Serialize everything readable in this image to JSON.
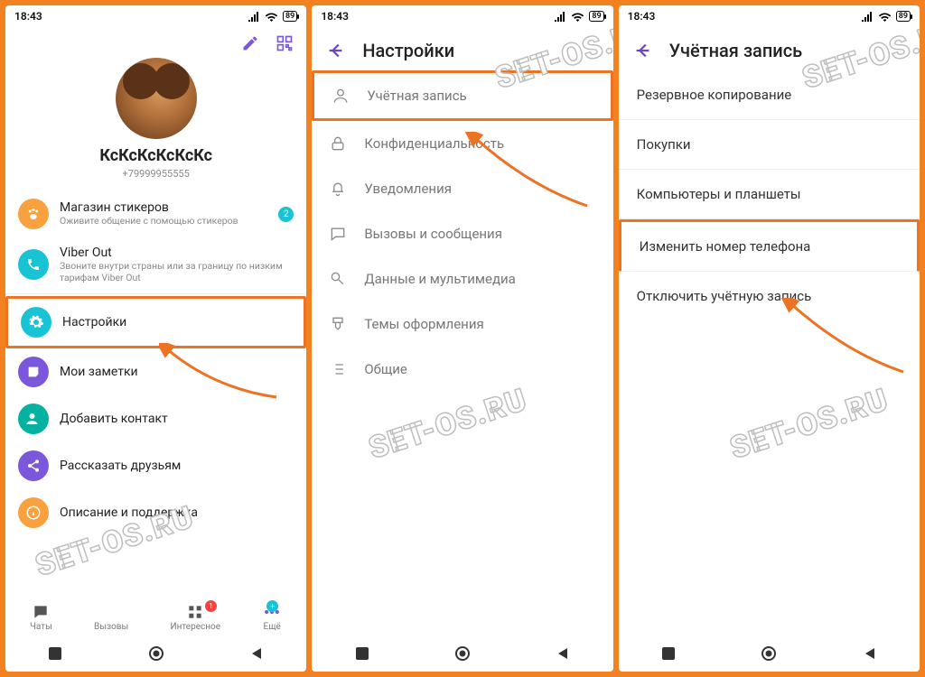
{
  "watermark": "SET-OS.RU",
  "status": {
    "time": "18:43",
    "battery": "89"
  },
  "colors": {
    "accent_orange": "#f38120",
    "highlight": "#ed7324",
    "purple": "#7b57db",
    "teal": "#17c3d4",
    "green_teal": "#05b2a2",
    "red": "#f1453d"
  },
  "panel1": {
    "username": "КсКсКсКсКсКс",
    "phone": "+79999955555",
    "items": [
      {
        "label": "Магазин стикеров",
        "sub": "Оживите общение с помощью стикеров",
        "icon": "paw-icon",
        "color": "#f9a03f",
        "badge": "2"
      },
      {
        "label": "Viber Out",
        "sub": "Звоните внутри страны или за границу по низким тарифам Viber Out",
        "icon": "phone-icon",
        "color": "#17c3d4"
      },
      {
        "label": "Настройки",
        "sub": "",
        "icon": "gear-icon",
        "color": "#17c3d4",
        "highlight": true
      },
      {
        "label": "Мои заметки",
        "sub": "",
        "icon": "note-icon",
        "color": "#7b57db"
      },
      {
        "label": "Добавить контакт",
        "sub": "",
        "icon": "add-contact-icon",
        "color": "#05b2a2"
      },
      {
        "label": "Рассказать друзьям",
        "sub": "",
        "icon": "share-icon",
        "color": "#7b57db"
      },
      {
        "label": "Описание и поддержка",
        "sub": "",
        "icon": "info-icon",
        "color": "#f9a03f"
      }
    ],
    "tabs": [
      {
        "label": "Чаты",
        "icon": "chat-icon"
      },
      {
        "label": "Вызовы",
        "icon": "phone-icon"
      },
      {
        "label": "Интересное",
        "icon": "grid-icon",
        "dot": "1",
        "dotColor": "#f1453d"
      },
      {
        "label": "Ещё",
        "icon": "dots-icon",
        "dot": "+",
        "dotColor": "#17c3d4"
      }
    ]
  },
  "panel2": {
    "title": "Настройки",
    "items": [
      {
        "label": "Учётная запись",
        "icon": "user-icon",
        "highlight": true
      },
      {
        "label": "Конфиденциальность",
        "icon": "lock-icon"
      },
      {
        "label": "Уведомления",
        "icon": "bell-icon"
      },
      {
        "label": "Вызовы и сообщения",
        "icon": "message-icon"
      },
      {
        "label": "Данные и мультимедиа",
        "icon": "media-icon"
      },
      {
        "label": "Темы оформления",
        "icon": "brush-icon"
      },
      {
        "label": "Общие",
        "icon": "list-icon"
      }
    ]
  },
  "panel3": {
    "title": "Учётная запись",
    "items": [
      {
        "label": "Резервное копирование"
      },
      {
        "label": "Покупки"
      },
      {
        "label": "Компьютеры и планшеты"
      },
      {
        "label": "Изменить номер телефона",
        "highlight": true
      },
      {
        "label": "Отключить учётную запись"
      }
    ]
  }
}
